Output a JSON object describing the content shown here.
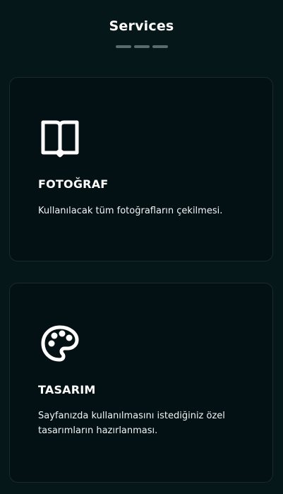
{
  "header": {
    "title": "Services"
  },
  "services": [
    {
      "icon": "open-book-icon",
      "title": "FOTOĞRAF",
      "description": "Kullanılacak tüm fotoğrafların çekilmesi."
    },
    {
      "icon": "paint-palette-icon",
      "title": "TASARIM",
      "description": "Sayfanızda kullanılmasını istediğiniz özel tasarımların hazırlanması."
    }
  ],
  "colors": {
    "background": "#061719",
    "card_background": "#031114",
    "card_border": "#1b2a2c",
    "divider": "#5b6a6b",
    "text": "#ffffff"
  }
}
